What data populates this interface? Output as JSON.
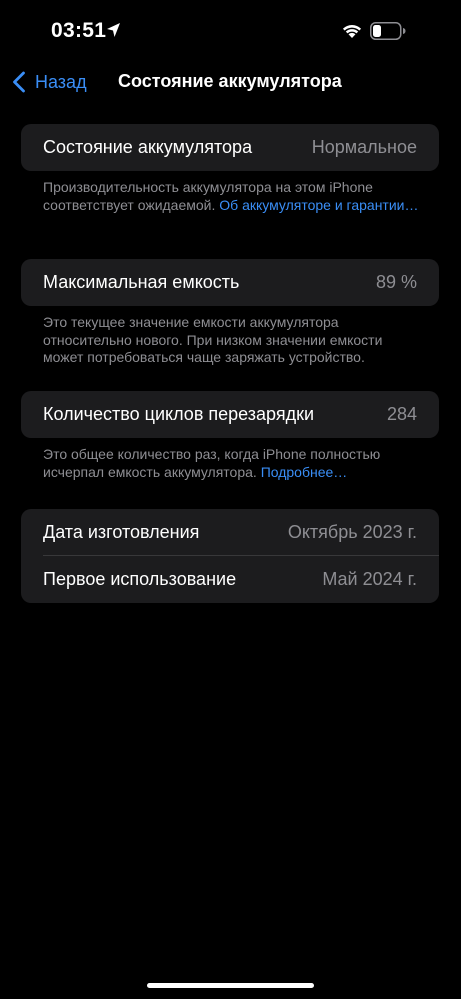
{
  "status_bar": {
    "time": "03:51",
    "icons": [
      "location-arrow-icon",
      "wifi-icon",
      "battery-low-icon"
    ]
  },
  "nav": {
    "back_label": "Назад",
    "title": "Состояние аккумулятора"
  },
  "sections": {
    "health": {
      "label": "Состояние аккумулятора",
      "value": "Нормальное",
      "footer_text": "Производительность аккумулятора на этом iPhone соответствует ожидаемой.",
      "footer_link": "Об аккумуляторе и гарантии…"
    },
    "capacity": {
      "label": "Максимальная емкость",
      "value": "89 %",
      "footer_text": "Это текущее значение емкости аккумулятора относительно нового. При низком значении емкости может потребоваться чаще заряжать устройство."
    },
    "cycles": {
      "label": "Количество циклов перезарядки",
      "value": "284",
      "footer_text": "Это общее количество раз, когда iPhone полностью исчерпал емкость аккумулятора.",
      "footer_link": "Подробнее…"
    },
    "dates": {
      "manufacture_label": "Дата изготовления",
      "manufacture_value": "Октябрь 2023 г.",
      "first_use_label": "Первое использование",
      "first_use_value": "Май 2024 г."
    }
  },
  "colors": {
    "background": "#000000",
    "cell": "#1c1c1e",
    "accent": "#3a8ef6",
    "secondary_text": "#8e8e93"
  }
}
